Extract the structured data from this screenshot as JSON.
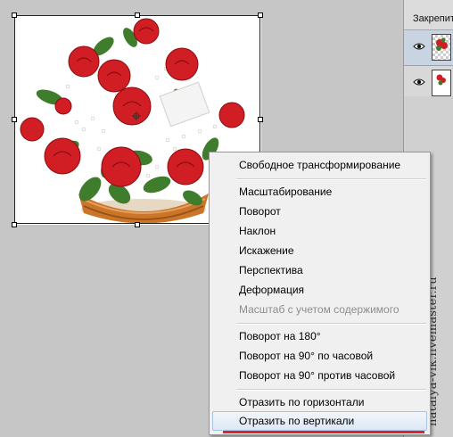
{
  "layers_panel": {
    "lock_label": "Закрепить",
    "layers": [
      {
        "name": "bouquet-layer",
        "visible_icon": "eye-icon",
        "active": true
      },
      {
        "name": "background-layer",
        "visible_icon": "eye-icon",
        "active": false
      }
    ]
  },
  "context_menu": {
    "groups": [
      [
        {
          "label": "Свободное трансформирование",
          "enabled": true
        }
      ],
      [
        {
          "label": "Масштабирование",
          "enabled": true
        },
        {
          "label": "Поворот",
          "enabled": true
        },
        {
          "label": "Наклон",
          "enabled": true
        },
        {
          "label": "Искажение",
          "enabled": true
        },
        {
          "label": "Перспектива",
          "enabled": true
        },
        {
          "label": "Деформация",
          "enabled": true
        },
        {
          "label": "Масштаб с учетом содержимого",
          "enabled": false
        }
      ],
      [
        {
          "label": "Поворот на 180°",
          "enabled": true
        },
        {
          "label": "Поворот на 90° по часовой",
          "enabled": true
        },
        {
          "label": "Поворот на 90° против часовой",
          "enabled": true
        }
      ],
      [
        {
          "label": "Отразить по горизонтали",
          "enabled": true
        },
        {
          "label": "Отразить по вертикали",
          "enabled": true,
          "highlighted": true
        }
      ]
    ]
  },
  "watermark": "natalya-vik.livemaster.ru",
  "colors": {
    "rose_red": "#d11d24",
    "leaf_green": "#3f7d2c",
    "basket": "#c9752a",
    "menu_hover_border": "#a8c4e2",
    "underline_red": "#d8252e"
  }
}
